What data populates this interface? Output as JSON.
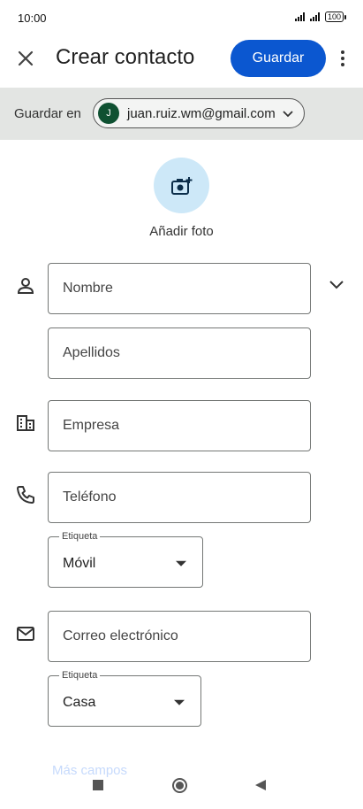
{
  "status_bar": {
    "time": "10:00",
    "battery": "100"
  },
  "header": {
    "title": "Crear contacto",
    "save_label": "Guardar",
    "close_icon": "close-icon",
    "more_icon": "more-vert-icon"
  },
  "save_in": {
    "label": "Guardar en",
    "avatar_initial": "J",
    "email": "juan.ruiz.wm@gmail.com"
  },
  "photo": {
    "label": "Añadir foto"
  },
  "fields": {
    "first_name": "Nombre",
    "last_name": "Apellidos",
    "company": "Empresa",
    "phone": "Teléfono",
    "phone_label_caption": "Etiqueta",
    "phone_label_value": "Móvil",
    "email": "Correo electrónico",
    "email_label_caption": "Etiqueta",
    "email_label_value": "Casa"
  },
  "more_fields": "Más campos",
  "colors": {
    "accent": "#0b57d0",
    "save_bar": "#e3e5e3",
    "photo_circle": "#cde8f8"
  }
}
